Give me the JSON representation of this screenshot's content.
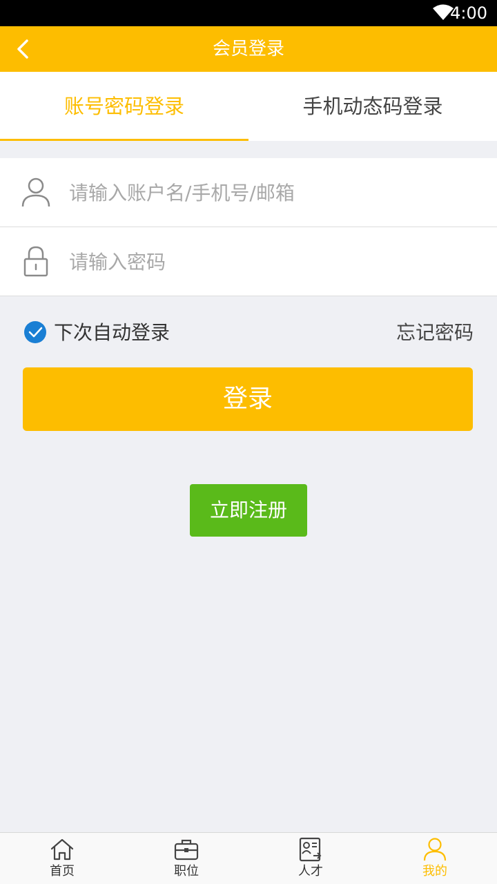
{
  "status_bar": {
    "time": "4:00",
    "wifi_icon": "wifi-icon"
  },
  "header": {
    "title": "会员登录",
    "back_icon": "chevron-left-icon"
  },
  "tabs": [
    {
      "label": "账号密码登录",
      "active": true
    },
    {
      "label": "手机动态码登录",
      "active": false
    }
  ],
  "form": {
    "account": {
      "placeholder": "请输入账户名/手机号/邮箱",
      "value": "",
      "icon": "user-icon"
    },
    "password": {
      "placeholder": "请输入密码",
      "value": "",
      "icon": "lock-icon"
    }
  },
  "options": {
    "auto_login_label": "下次自动登录",
    "auto_login_checked": true,
    "forgot_label": "忘记密码"
  },
  "login_button": "登录",
  "register_button": "立即注册",
  "nav": [
    {
      "label": "首页",
      "icon": "home-icon",
      "active": false
    },
    {
      "label": "职位",
      "icon": "briefcase-icon",
      "active": false
    },
    {
      "label": "人才",
      "icon": "resume-icon",
      "active": false
    },
    {
      "label": "我的",
      "icon": "profile-icon",
      "active": true
    }
  ],
  "colors": {
    "primary": "#fdbd00",
    "register_green": "#5aba1a",
    "check_blue": "#1a7fd4",
    "background": "#eff0f4"
  }
}
